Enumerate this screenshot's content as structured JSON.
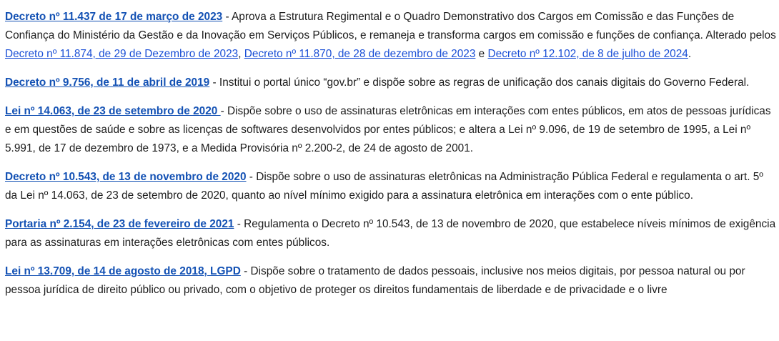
{
  "entries": [
    {
      "link": "Decreto nº 11.437 de 17 de março de 2023",
      "text": " - Aprova a Estrutura Regimental e o Quadro Demonstrativo dos Cargos em Comissão e das Funções de Confiança do Ministério da Gestão e da Inovação em Serviços Públicos, e remaneja e transforma cargos em comissão e funções de confiança.",
      "amend_prefix": "Alterado pelos ",
      "amend_links": [
        "Decreto nº 11.874, de 29 de Dezembro de 2023",
        "Decreto nº 11.870, de 28 de dezembro de 2023",
        "Decreto nº 12.102, de 8 de julho de 2024"
      ],
      "amend_sep_1": ", ",
      "amend_sep_2": " e ",
      "amend_suffix": "."
    },
    {
      "link": "Decreto nº 9.756, de 11 de abril de 2019",
      "text": " - Institui o portal único “gov.br” e dispõe sobre as regras de unificação dos canais digitais do Governo Federal."
    },
    {
      "link": "Lei nº 14.063, de 23 de setembro de 2020 ",
      "text": "- Dispõe sobre o uso de assinaturas eletrônicas em interações com entes públicos, em atos de pessoas jurídicas e em questões de saúde e sobre as licenças de softwares desenvolvidos por entes públicos; e altera a Lei nº 9.096, de 19 de setembro de 1995, a Lei nº 5.991, de 17 de dezembro de 1973, e a Medida Provisória nº 2.200-2, de 24 de agosto de 2001."
    },
    {
      "link": "Decreto nº 10.543, de 13 de novembro de 2020",
      "text": " - Dispõe sobre o uso de assinaturas eletrônicas na Administração Pública Federal e regulamenta o art. 5º da Lei nº 14.063, de 23 de setembro de 2020, quanto ao nível mínimo exigido para a assinatura eletrônica em interações com o ente público."
    },
    {
      "link": "Portaria nº 2.154, de 23 de fevereiro de 2021",
      "text": " - Regulamenta o Decreto nº 10.543, de 13 de novembro de 2020, que estabelece níveis mínimos de exigência para as assinaturas em interações eletrônicas com entes públicos."
    },
    {
      "link": "Lei nº 13.709, de 14 de agosto de 2018, LGPD",
      "text": " - Dispõe sobre o tratamento de dados pessoais, inclusive nos meios digitais, por pessoa natural ou por pessoa jurídica de direito público ou privado, com o objetivo de proteger os direitos fundamentais de liberdade e de privacidade e o livre"
    }
  ],
  "colors": {
    "link": "#1351b4",
    "text": "#1c1c1c",
    "background": "#ffffff"
  }
}
